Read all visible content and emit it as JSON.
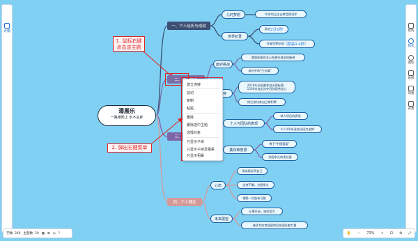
{
  "left_sidebar": {
    "outline_label": "大纲"
  },
  "right_sidebar": {
    "items": [
      {
        "label": "结构",
        "icon": "structure-icon"
      },
      {
        "label": "样式",
        "icon": "style-icon"
      },
      {
        "label": "图标",
        "icon": "emoji-icon"
      },
      {
        "label": "贴纸",
        "icon": "sticker-icon"
      },
      {
        "label": "风格",
        "icon": "theme-icon"
      },
      {
        "label": "背景",
        "icon": "background-icon"
      }
    ]
  },
  "root": {
    "title": "潘展乐",
    "subtitle": "一路难而上 水不言弃"
  },
  "branches": {
    "b1": {
      "label": "一、个人经历与成就",
      "color": "#3d4f73"
    },
    "b2": {
      "label": "二、勇于挑战",
      "color": "#7b6fa8"
    },
    "b3": {
      "label": "三、团队协作",
      "color": "#7f66a8"
    },
    "b4": {
      "label": "四、个人理念",
      "color": "#d49a9a"
    }
  },
  "nodes": {
    "childhood": "儿时梦想",
    "childhood_leaf": "10岁时立志去拿世界冠军",
    "world_record": "世界纪录",
    "wr_leaf1_prefix": "游进",
    "wr_leaf1_value": "2分1秒",
    "wr_leaf2_prefix": "打破世界纪录（",
    "wr_leaf2_value": "提高0.4秒",
    "wr_leaf2_suffix": "）",
    "face_challenge": "面对挑战",
    "fc_leaf1": "遇强愈强的决心和勇往直前的精神",
    "fc_leaf2": "成长中的\"生长痛\"",
    "persist": "坚持",
    "p_leaf1": "2019年全国夏季游泳锦标赛\n1500米自由泳夺冠别居绝佳心",
    "p_leaf2": "倾注成功来自日常积累",
    "individual_team": "个人与团队的表现",
    "it_leaf1": "单人项目的表现",
    "it_leaf2": "4×100米混合泳接力金牌",
    "team_honor": "集体荣誉感",
    "th_leaf1": "勇于\"中国速度\"",
    "th_leaf2": "为国争光的责任感",
    "mindset": "心态",
    "m_leaf1": "用成绩证明自己",
    "m_leaf2": "坚持不懈，为国争光",
    "m_leaf3": "钢筋一切皆有可能",
    "future": "未来展望",
    "f_leaf1": "从零开始，继续努力",
    "f_leaf2": "继续为体育强国和竞技国贡献力量"
  },
  "context_menu": {
    "items": [
      "建立连接",
      "剪切",
      "复制",
      "粘贴",
      "删除",
      "删除选中主题",
      "选择对象",
      "只显示子树",
      "只显示子树及祖辈",
      "只显示祖辈"
    ]
  },
  "annotations": {
    "a1_line1": "1. 鼠标右键",
    "a1_line2": "点击该主题",
    "a2": "2. 弹出右键菜单"
  },
  "status_bar": {
    "word_count": "字数: 266",
    "topic_count": "主题数: 29"
  },
  "zoom": {
    "level": "73%"
  }
}
